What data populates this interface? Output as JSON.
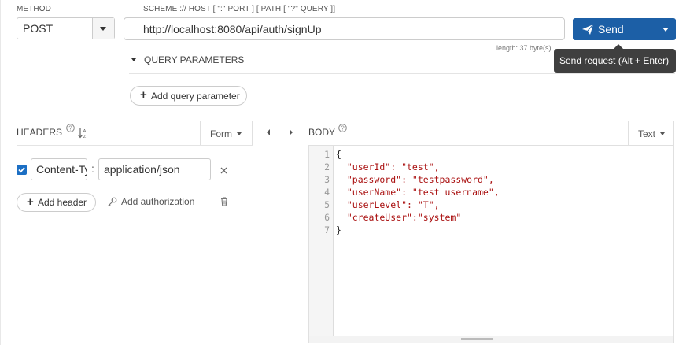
{
  "method": {
    "label": "METHOD",
    "value": "POST"
  },
  "url": {
    "label": "SCHEME :// HOST [ \":\" PORT ] [ PATH [ \"?\" QUERY ]]",
    "value": "http://localhost:8080/api/auth/signUp",
    "length_text": "length: 37 byte(s)"
  },
  "send": {
    "label": "Send",
    "tooltip": "Send request (Alt + Enter)",
    "accent": "#1c5fa6"
  },
  "query": {
    "title": "QUERY PARAMETERS",
    "add_label": "Add query parameter"
  },
  "headers": {
    "title": "HEADERS",
    "mode": "Form",
    "rows": [
      {
        "enabled": true,
        "name": "Content-Type",
        "value": "application/json"
      }
    ],
    "add_header_label": "Add header",
    "add_auth_label": "Add authorization"
  },
  "body": {
    "title": "BODY",
    "mode": "Text",
    "lines": [
      "{",
      "  \"userId\": \"test\",",
      "  \"password\": \"testpassword\",",
      "  \"userName\": \"test username\",",
      "  \"userLevel\": \"T\",",
      "  \"createUser\":\"system\"",
      "}"
    ],
    "line_numbers": [
      "1",
      "2",
      "3",
      "4",
      "5",
      "6",
      "7"
    ]
  }
}
